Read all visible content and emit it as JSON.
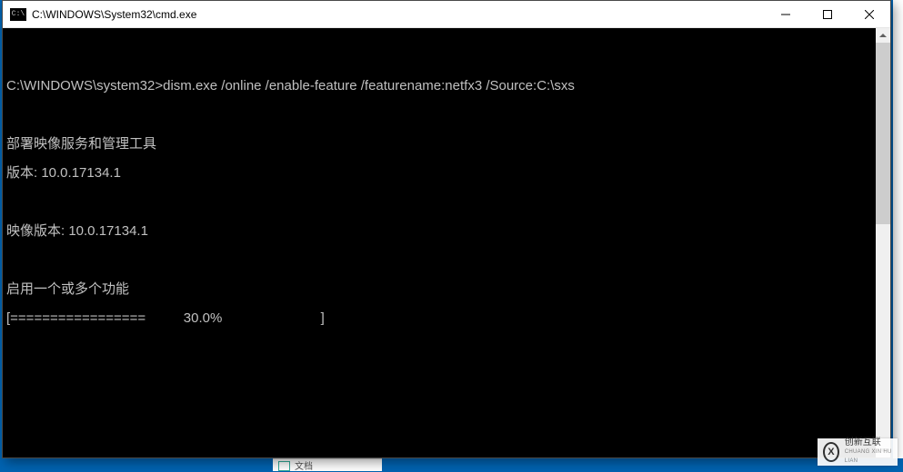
{
  "window": {
    "title": "C:\\WINDOWS\\System32\\cmd.exe",
    "icon_label": "C:\\"
  },
  "controls": {
    "minimize_tip": "Minimize",
    "maximize_tip": "Maximize",
    "close_tip": "Close"
  },
  "terminal": {
    "prompt": "C:\\WINDOWS\\system32>",
    "command": "dism.exe /online /enable-feature /featurename:netfx3 /Source:C:\\sxs",
    "lines": {
      "l1": "部署映像服务和管理工具",
      "l2": "版本: 10.0.17134.1",
      "l3": "映像版本: 10.0.17134.1",
      "l4": "启用一个或多个功能",
      "progress": "[=================          30.0%                          ]"
    }
  },
  "background": {
    "bottom_item": "文档"
  },
  "watermark": {
    "glyph": "X",
    "line1": "创新互联",
    "line2": "CHUANG XIN HU LIAN"
  }
}
